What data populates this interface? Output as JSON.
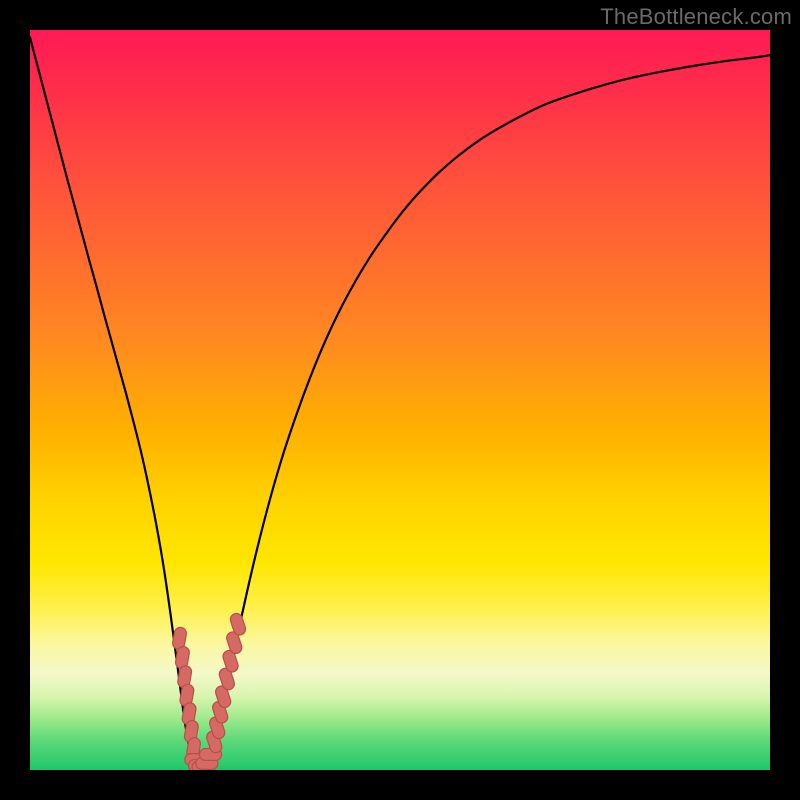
{
  "watermark": "TheBottleneck.com",
  "colors": {
    "frame": "#000000",
    "curve": "#000000",
    "marker_fill": "#d46a63",
    "marker_stroke": "#b84f48",
    "gradient_top": "#ff1a55",
    "gradient_bottom": "#1ec76a"
  },
  "chart_data": {
    "type": "line",
    "title": "",
    "xlabel": "",
    "ylabel": "",
    "xlim": [
      0,
      100
    ],
    "ylim": [
      0,
      100
    ],
    "grid": false,
    "legend": false,
    "x": [
      0,
      1,
      2,
      3,
      4,
      5,
      6,
      7,
      8,
      9,
      10,
      11,
      12,
      13,
      14,
      15,
      16,
      17,
      18,
      19,
      20,
      21,
      22,
      23,
      24,
      25,
      26,
      27,
      28,
      30,
      32,
      34,
      36,
      38,
      40,
      42,
      44,
      46,
      48,
      50,
      52,
      55,
      58,
      61,
      64,
      67,
      70,
      74,
      78,
      82,
      86,
      90,
      94,
      98,
      100
    ],
    "y": [
      99,
      95.2,
      91.4,
      87.6,
      83.8,
      80,
      76.3,
      72.6,
      68.9,
      65.3,
      61.6,
      58,
      54.4,
      50.8,
      47,
      43,
      38.5,
      33.5,
      27.8,
      21,
      13.5,
      6,
      1.2,
      0.2,
      1.4,
      4.2,
      8.3,
      13,
      18,
      27,
      35,
      42,
      48,
      53.4,
      58.2,
      62.4,
      66.1,
      69.4,
      72.3,
      75,
      77.4,
      80.5,
      83.1,
      85.3,
      87.1,
      88.7,
      90.1,
      91.5,
      92.7,
      93.7,
      94.5,
      95.2,
      95.8,
      96.3,
      96.6
    ],
    "markers": {
      "left_cluster": {
        "x": [
          20.2,
          20.6,
          20.9,
          21.2,
          21.5,
          21.8,
          22.1
        ],
        "y": [
          17.8,
          15.2,
          12.6,
          10.1,
          7.6,
          5.2,
          2.9
        ]
      },
      "bottom_cluster": {
        "x": [
          22.4,
          22.9,
          23.4,
          23.9,
          24.4
        ],
        "y": [
          1.4,
          0.6,
          0.4,
          0.9,
          2.1
        ]
      },
      "right_cluster": {
        "x": [
          24.9,
          25.3,
          25.7,
          26.1,
          26.6,
          27.1,
          27.6,
          28.1
        ],
        "y": [
          3.8,
          5.7,
          7.8,
          9.9,
          12.3,
          14.7,
          17.2,
          19.7
        ]
      }
    }
  }
}
